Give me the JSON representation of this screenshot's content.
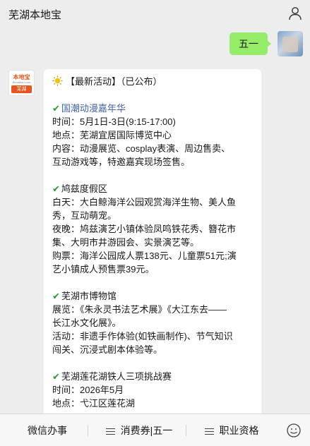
{
  "header": {
    "title": "芜湖本地宝",
    "user_icon": "user-icon"
  },
  "messages": {
    "user_text": "五一"
  },
  "bot": {
    "avatar": {
      "logo_text": "本地宝",
      "logo_sub": "Bendibao.com",
      "logo_city": "芜湖"
    },
    "headline": "【最新活动】（已公布）",
    "lines": [
      {
        "type": "title",
        "text": "国潮动漫嘉年华",
        "color": "blue"
      },
      {
        "type": "text",
        "text": "时间：5月1日-3日(9:15-17:00)"
      },
      {
        "type": "text",
        "text": "地点：芜湖宜居国际博览中心"
      },
      {
        "type": "text",
        "text": "内容：动漫展览、cosplay表演、周边售卖、"
      },
      {
        "type": "text",
        "text": "互动游戏等，特邀嘉宾现场签售。"
      },
      {
        "type": "blank"
      },
      {
        "type": "title",
        "text": "鸠兹度假区"
      },
      {
        "type": "text",
        "text": "白天：大白鲸海洋公园观赏海洋生物、美人鱼"
      },
      {
        "type": "text",
        "text": "秀，互动萌宠。"
      },
      {
        "type": "text",
        "text": "夜晚：鸠兹演艺小镇体验凤鸣铁花秀、簪花市"
      },
      {
        "type": "text",
        "text": "集、大明市井游园会、实景演艺等。"
      },
      {
        "type": "text",
        "text": "购票：海洋公园成人票138元、儿童票51元;演"
      },
      {
        "type": "text",
        "text": "艺小镇成人预售票39元。"
      },
      {
        "type": "blank"
      },
      {
        "type": "title",
        "text": "芜湖市博物馆"
      },
      {
        "type": "text",
        "text": "展览：《朱永灵书法艺术展》《大江东去——"
      },
      {
        "type": "text",
        "text": "长江水文化展》。"
      },
      {
        "type": "text",
        "text": "活动：非遗手作体验(如铁画制作)、节气知识"
      },
      {
        "type": "text",
        "text": "闯关、沉浸式剧本体验等。"
      },
      {
        "type": "blank"
      },
      {
        "type": "title",
        "text": "芜湖莲花湖铁人三项挑战赛"
      },
      {
        "type": "text",
        "text": "时间：2026年5月"
      },
      {
        "type": "text",
        "text": "地点：弋江区莲花湖"
      }
    ]
  },
  "menu": {
    "items": [
      {
        "label": "微信办事",
        "has_icon": false
      },
      {
        "label": "消费券|五一",
        "has_icon": true
      },
      {
        "label": "职业资格",
        "has_icon": true
      }
    ],
    "keyboard_icon": "emoji-keyboard-icon"
  },
  "colors": {
    "background": "#ededed",
    "user_bubble": "#95ec69",
    "link_blue": "#4064a8",
    "check_green": "#2c9a2c"
  }
}
